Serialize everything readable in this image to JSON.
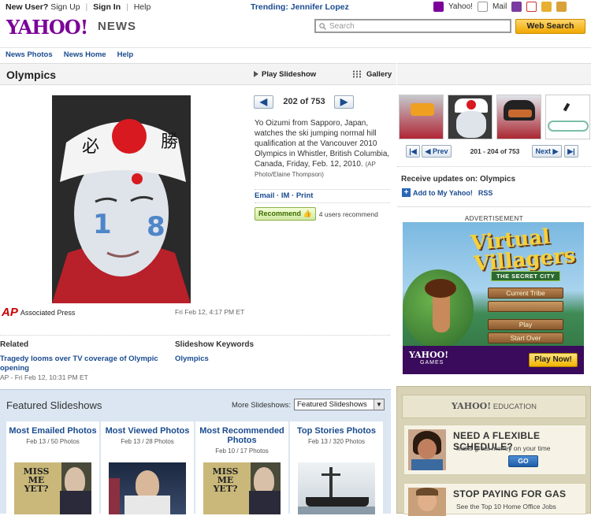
{
  "topbar": {
    "new_user": "New User?",
    "sign_up": "Sign Up",
    "sign_in": "Sign In",
    "help": "Help",
    "trending": "Trending: Jennifer Lopez",
    "yahoo": "Yahoo!",
    "mail": "Mail"
  },
  "header": {
    "logo": "YAHOO!",
    "section": "NEWS",
    "search_placeholder": "Search",
    "web_search": "Web Search"
  },
  "nav": [
    "News Photos",
    "News Home",
    "Help"
  ],
  "titlebar": {
    "title": "Olympics",
    "play": "Play Slideshow",
    "gallery": "Gallery"
  },
  "photo": {
    "counter": "202 of 753",
    "caption": "Yo Oizumi from Sapporo, Japan, watches the ski jumping normal hill qualification at the Vancouver 2010 Olympics in Whistler, British Columbia, Canada, Friday, Feb. 12, 2010.",
    "credit": "(AP Photo/Elaine Thompson)",
    "source": "Associated Press",
    "date": "Fri Feb 12, 4:17 PM ET",
    "email": "Email",
    "im": "IM",
    "print": "Print",
    "recommend": "Recommend",
    "recommend_count": "4 users recommend"
  },
  "related": {
    "heading": "Related",
    "link": "Tragedy looms over TV coverage of Olympic opening",
    "meta": "AP - Fri Feb 12, 10:31 PM ET",
    "kw_heading": "Slideshow Keywords",
    "kw_link": "Olympics"
  },
  "featured": {
    "title": "Featured Slideshows",
    "more_label": "More Slideshows:",
    "more_value": "Featured Slideshows",
    "cards": [
      {
        "title": "Most Emailed Photos",
        "meta": "Feb 13 / 50 Photos",
        "thumb_text": "MISS ME YET?"
      },
      {
        "title": "Most Viewed Photos",
        "meta": "Feb 13 / 28 Photos",
        "thumb_text": ""
      },
      {
        "title": "Most Recommended Photos",
        "meta": "Feb 10 / 17 Photos",
        "thumb_text": "MISS ME YET?"
      },
      {
        "title": "Top Stories Photos",
        "meta": "Feb 13 / 320 Photos",
        "thumb_text": ""
      }
    ]
  },
  "sidebar": {
    "prev": "Prev",
    "next": "Next",
    "page_count": "201 - 204 of 753",
    "updates": "Receive updates on: Olympics",
    "add_my_yahoo": "Add to My Yahoo!",
    "rss": "RSS",
    "ad_label": "ADVERTISEMENT"
  },
  "ad": {
    "title_line1": "Virtual",
    "title_line2": "Villagers",
    "subtitle": "THE SECRET CITY",
    "menu": [
      "Current Tribe",
      "Play",
      "Start Over"
    ],
    "brand": "YAHOO!",
    "brand_sub": "GAMES",
    "play_now": "Play Now!"
  },
  "education": {
    "head_brand": "YAHOO!",
    "head_section": "EDUCATION",
    "cards": [
      {
        "title": "NEED A FLEXIBLE SCHEDULE?",
        "sub": "Make great money on your time",
        "button": "GO"
      },
      {
        "title": "STOP PAYING FOR GAS",
        "sub": "See the Top 10 Home Office Jobs",
        "button": ""
      }
    ]
  },
  "colors": {
    "brand_purple": "#7b0099",
    "link_blue": "#1a4b8f",
    "search_button": "#f0a800"
  }
}
